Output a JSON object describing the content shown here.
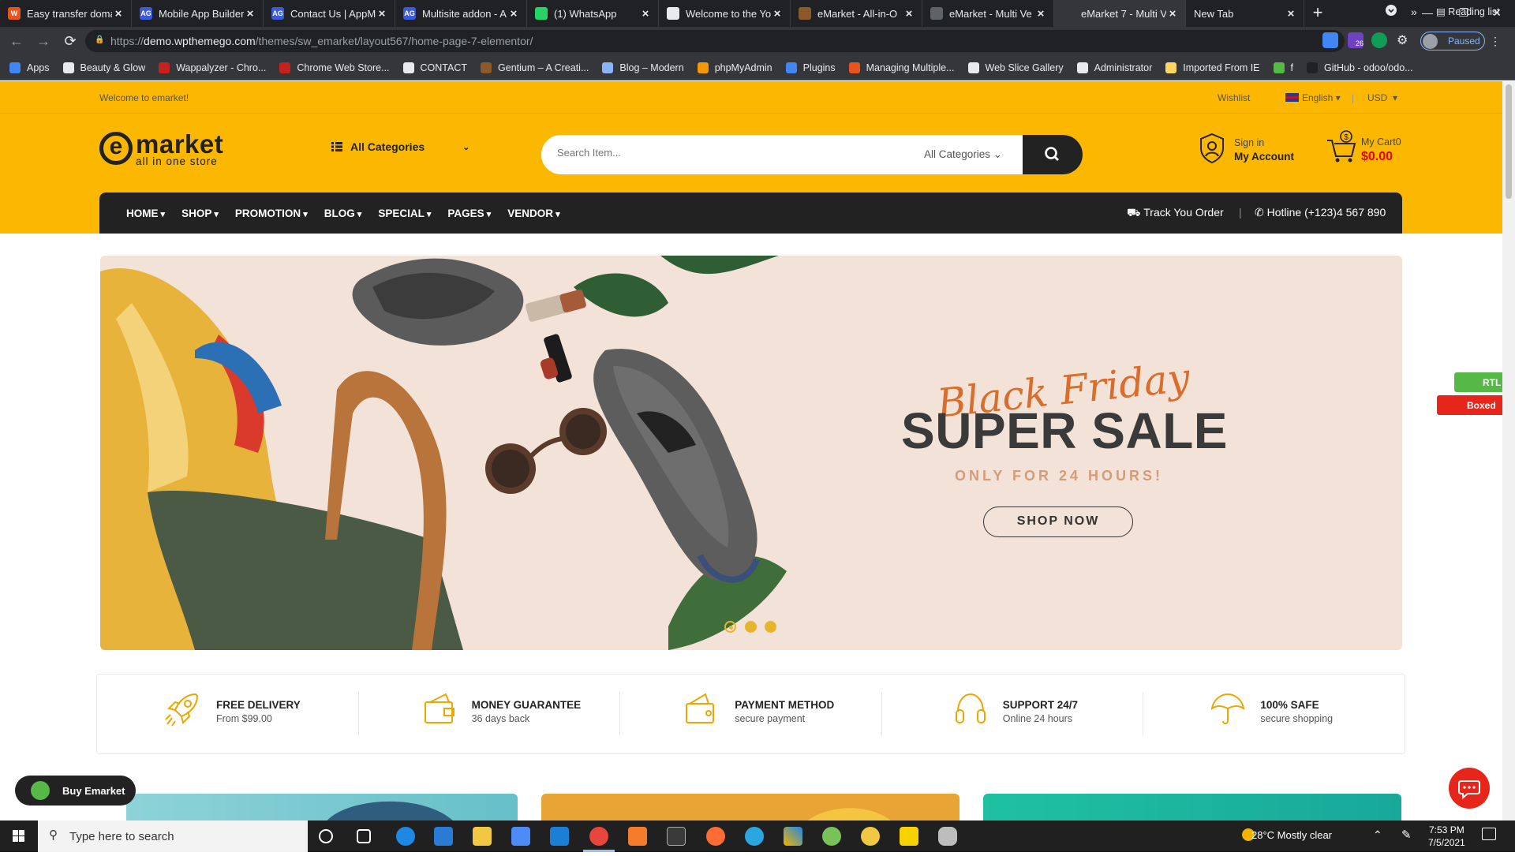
{
  "browser": {
    "tabs": [
      {
        "title": "Easy transfer doma",
        "fav_color": "#e8541f",
        "fav_text": "W"
      },
      {
        "title": "Mobile App Builder",
        "fav_color": "#3b5bdb",
        "fav_text": "AG"
      },
      {
        "title": "Contact Us | AppM",
        "fav_color": "#3b5bdb",
        "fav_text": "AG"
      },
      {
        "title": "Multisite addon - A",
        "fav_color": "#3b5bdb",
        "fav_text": "AG"
      },
      {
        "title": "(1) WhatsApp",
        "fav_color": "#25d366",
        "fav_text": ""
      },
      {
        "title": "Welcome to the Yo",
        "fav_color": "#e8eaed",
        "fav_text": ""
      },
      {
        "title": "eMarket - All-in-O",
        "fav_color": "#8a5a2b",
        "fav_text": ""
      },
      {
        "title": "eMarket - Multi Ve",
        "fav_color": "#5f6368",
        "fav_text": ""
      },
      {
        "title": "eMarket 7 - Multi V",
        "fav_color": "#35363a",
        "fav_text": ""
      },
      {
        "title": "New Tab",
        "fav_color": "",
        "fav_text": ""
      }
    ],
    "url_prefix": "https://",
    "url_domain": "demo.wpthemego.com",
    "url_path": "/themes/sw_emarket/layout567/home-page-7-elementor/",
    "profile_label": "Paused",
    "ext_badge": "26",
    "bookmarks": [
      {
        "label": "Apps",
        "color": "#4285f4"
      },
      {
        "label": "Beauty & Glow",
        "color": "#e8eaed"
      },
      {
        "label": "Wappalyzer - Chro...",
        "color": "#c5221f"
      },
      {
        "label": "Chrome Web Store...",
        "color": "#c5221f"
      },
      {
        "label": "CONTACT",
        "color": "#e8eaed"
      },
      {
        "label": "Gentium – A Creati...",
        "color": "#8a5a2b"
      },
      {
        "label": "Blog – Modern",
        "color": "#8ab4f8"
      },
      {
        "label": "phpMyAdmin",
        "color": "#f29900"
      },
      {
        "label": "Plugins",
        "color": "#4285f4"
      },
      {
        "label": "Managing Multiple...",
        "color": "#e8541f"
      },
      {
        "label": "Web Slice Gallery",
        "color": "#e8eaed"
      },
      {
        "label": "Administrator",
        "color": "#e8eaed"
      },
      {
        "label": "Imported From IE",
        "color": "#fdd663"
      },
      {
        "label": "f",
        "color": "#56b847"
      },
      {
        "label": "GitHub - odoo/odo...",
        "color": "#202124"
      }
    ],
    "bookmarks_more": "»",
    "reading_list": "Reading list"
  },
  "site": {
    "topbar": {
      "welcome": "Welcome to emarket!",
      "wishlist": "Wishlist",
      "language": "English",
      "currency": "USD"
    },
    "logo": {
      "letter": "e",
      "word": "market",
      "tagline": "all in one store"
    },
    "categories_label": "All Categories",
    "search": {
      "placeholder": "Search Item...",
      "category": "All Categories"
    },
    "account": {
      "line1": "Sign in",
      "line2": "My Account"
    },
    "cart": {
      "line1": "My Cart0",
      "total": "$0.00"
    },
    "nav": [
      "HOME",
      "SHOP",
      "PROMOTION",
      "BLOG",
      "SPECIAL",
      "PAGES",
      "VENDOR"
    ],
    "track_order": "Track You Order",
    "hotline": "Hotline (+123)4 567 890",
    "hero": {
      "script": "Black Friday",
      "title": "SUPER SALE",
      "subtitle": "ONLY FOR 24 HOURS!",
      "cta": "SHOP NOW",
      "active_slide": 1,
      "slide_count": 3
    },
    "features": [
      {
        "title": "FREE DELIVERY",
        "desc": "From $99.00",
        "icon": "rocket-icon"
      },
      {
        "title": "MONEY GUARANTEE",
        "desc": "36 days back",
        "icon": "wallet-icon"
      },
      {
        "title": "PAYMENT METHOD",
        "desc": "secure payment",
        "icon": "payment-icon"
      },
      {
        "title": "SUPPORT 24/7",
        "desc": "Online 24 hours",
        "icon": "headset-icon"
      },
      {
        "title": "100% SAFE",
        "desc": "secure shopping",
        "icon": "umbrella-icon"
      }
    ],
    "rtl_label": "RTL",
    "boxed_label": "Boxed",
    "buy_label": "Buy Emarket",
    "accent": "#fcb700",
    "dark": "#222222",
    "price_red": "#e7000b"
  },
  "taskbar": {
    "search_placeholder": "Type here to search",
    "weather": "28°C  Mostly clear",
    "time": "7:53 PM",
    "date": "7/5/2021"
  }
}
